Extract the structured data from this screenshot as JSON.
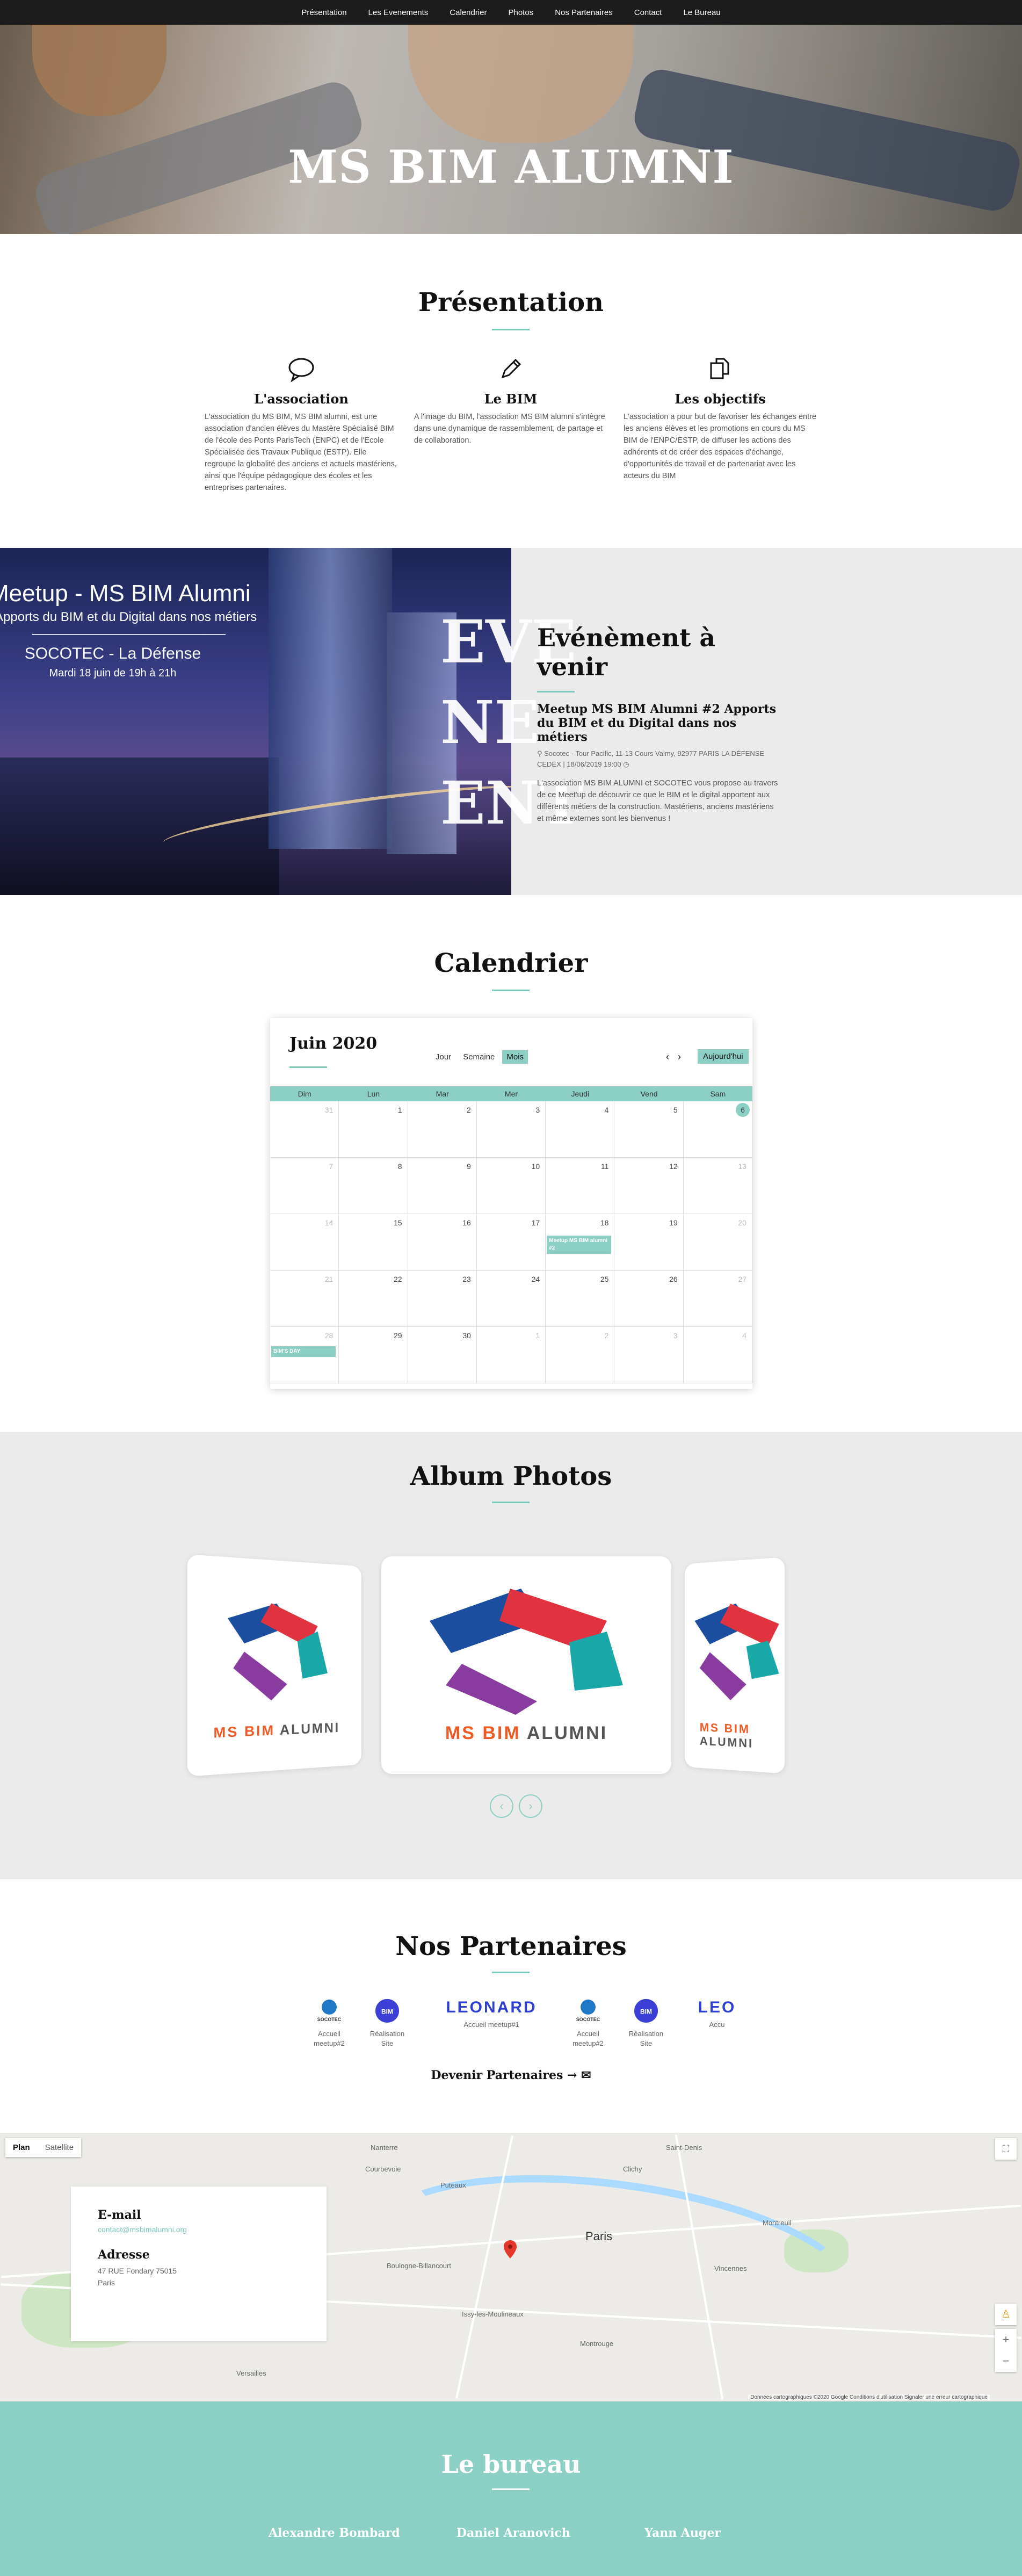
{
  "nav": [
    "Présentation",
    "Les Evenements",
    "Calendrier",
    "Photos",
    "Nos Partenaires",
    "Contact",
    "Le Bureau"
  ],
  "hero": {
    "title": "MS BIM ALUMNI"
  },
  "presentation": {
    "title": "Présentation",
    "columns": [
      {
        "icon": "speech-bubble-icon",
        "title": "L'association",
        "text": "L'association du MS BIM, MS BIM alumni, est une association d'ancien élèves du Mastère Spécialisé BIM de l'école des Ponts ParisTech (ENPC) et de l'Ecole Spécialisée des Travaux Publique (ESTP). Elle regroupe la globalité des anciens et actuels mastériens, ainsi que l'équipe pédagogique des écoles et les entreprises partenaires."
      },
      {
        "icon": "pencil-icon",
        "title": "Le BIM",
        "text": "A l'image du BIM, l'association MS BIM alumni s'intègre dans une dynamique de rassemblement, de partage et de collaboration."
      },
      {
        "icon": "copy-icon",
        "title": "Les objectifs",
        "text": "L'association a pour but de favoriser les échanges entre les anciens élèves et les promotions en cours du MS BIM de l'ENPC/ESTP, de diffuser les actions des adhérents et de créer des espaces d'échange, d'opportunités de travail et de partenariat avec les acteurs du BIM"
      }
    ]
  },
  "event": {
    "image": {
      "title": "Meetup - MS BIM Alumni",
      "subtitle": "Apports du BIM et du Digital dans nos métiers",
      "location": "SOCOTEC - La Défense",
      "date": "Mardi 18 juin de 19h à 21h"
    },
    "overlay_word": [
      "EVE",
      "NE",
      "ENT"
    ],
    "section_title": "Evénèment à venir",
    "title": "Meetup MS BIM Alumni #2 Apports du BIM et du Digital dans nos métiers",
    "meta": "Socotec - Tour Pacific, 11-13 Cours Valmy, 92977 PARIS LA DÉFENSE CEDEX | 18/06/2019 19:00",
    "text": "L'association MS BIM ALUMNI et SOCOTEC vous propose au travers de ce Meet'up de découvrir ce que le BIM et le digital apportent aux différents métiers de la construction. Mastériens, anciens mastériens et même externes sont les bienvenus !"
  },
  "calendar": {
    "section_title": "Calendrier",
    "month": "Juin 2020",
    "views": [
      "Jour",
      "Semaine",
      "Mois"
    ],
    "active_view": "Mois",
    "prev": "‹",
    "next": "›",
    "today": "Aujourd'hui",
    "weekdays": [
      "Dim",
      "Lun",
      "Mar",
      "Mer",
      "Jeudi",
      "Vend",
      "Sam"
    ],
    "days": [
      [
        "31",
        "1",
        "2",
        "3",
        "4",
        "5",
        "6"
      ],
      [
        "7",
        "8",
        "9",
        "10",
        "11",
        "12",
        "13"
      ],
      [
        "14",
        "15",
        "16",
        "17",
        "18",
        "19",
        "20"
      ],
      [
        "21",
        "22",
        "23",
        "24",
        "25",
        "26",
        "27"
      ],
      [
        "28",
        "29",
        "30",
        "1",
        "2",
        "3",
        "4"
      ]
    ],
    "event_a": "Meetup MS BIM alumni #2",
    "event_b": "BIM'S DAY"
  },
  "album": {
    "title": "Album Photos",
    "logo_ms": "MS BIM",
    "logo_alumni": "ALUMNI",
    "prev": "‹",
    "next": "›"
  },
  "partners": {
    "title": "Nos Partenaires",
    "items": [
      {
        "name": "SOCOTEC",
        "caption": "Accueil meetup#2"
      },
      {
        "name": "BIM",
        "caption": "Réalisation Site"
      },
      {
        "name": "LEONARD",
        "caption": "Accueil meetup#1"
      },
      {
        "name": "SOCOTEC",
        "caption": "Accueil meetup#2"
      },
      {
        "name": "BIM",
        "caption": "Réalisation Site"
      },
      {
        "name": "LEO",
        "caption": "Accu"
      }
    ],
    "cta": "Devenir Partenaires →"
  },
  "map": {
    "tabs": [
      "Plan",
      "Satellite"
    ],
    "labels": [
      "Nanterre",
      "Puteaux",
      "Courbevoie",
      "Paris",
      "Montreuil",
      "Boulogne-Billancourt",
      "Vincennes",
      "Versailles",
      "Issy-les-Moulineaux",
      "Montrouge",
      "Clichy",
      "Saint-Denis"
    ],
    "footer": "Données cartographiques ©2020 Google   Conditions d'utilisation   Signaler une erreur cartographique"
  },
  "contact": {
    "email_label": "E-mail",
    "email": "contact@msbimalumni.org",
    "address_label": "Adresse",
    "address1": "47 RUE Fondary 75015",
    "address2": "Paris"
  },
  "bureau": {
    "title": "Le bureau",
    "members": [
      "Alexandre Bombard",
      "Daniel Aranovich",
      "Yann Auger"
    ]
  }
}
